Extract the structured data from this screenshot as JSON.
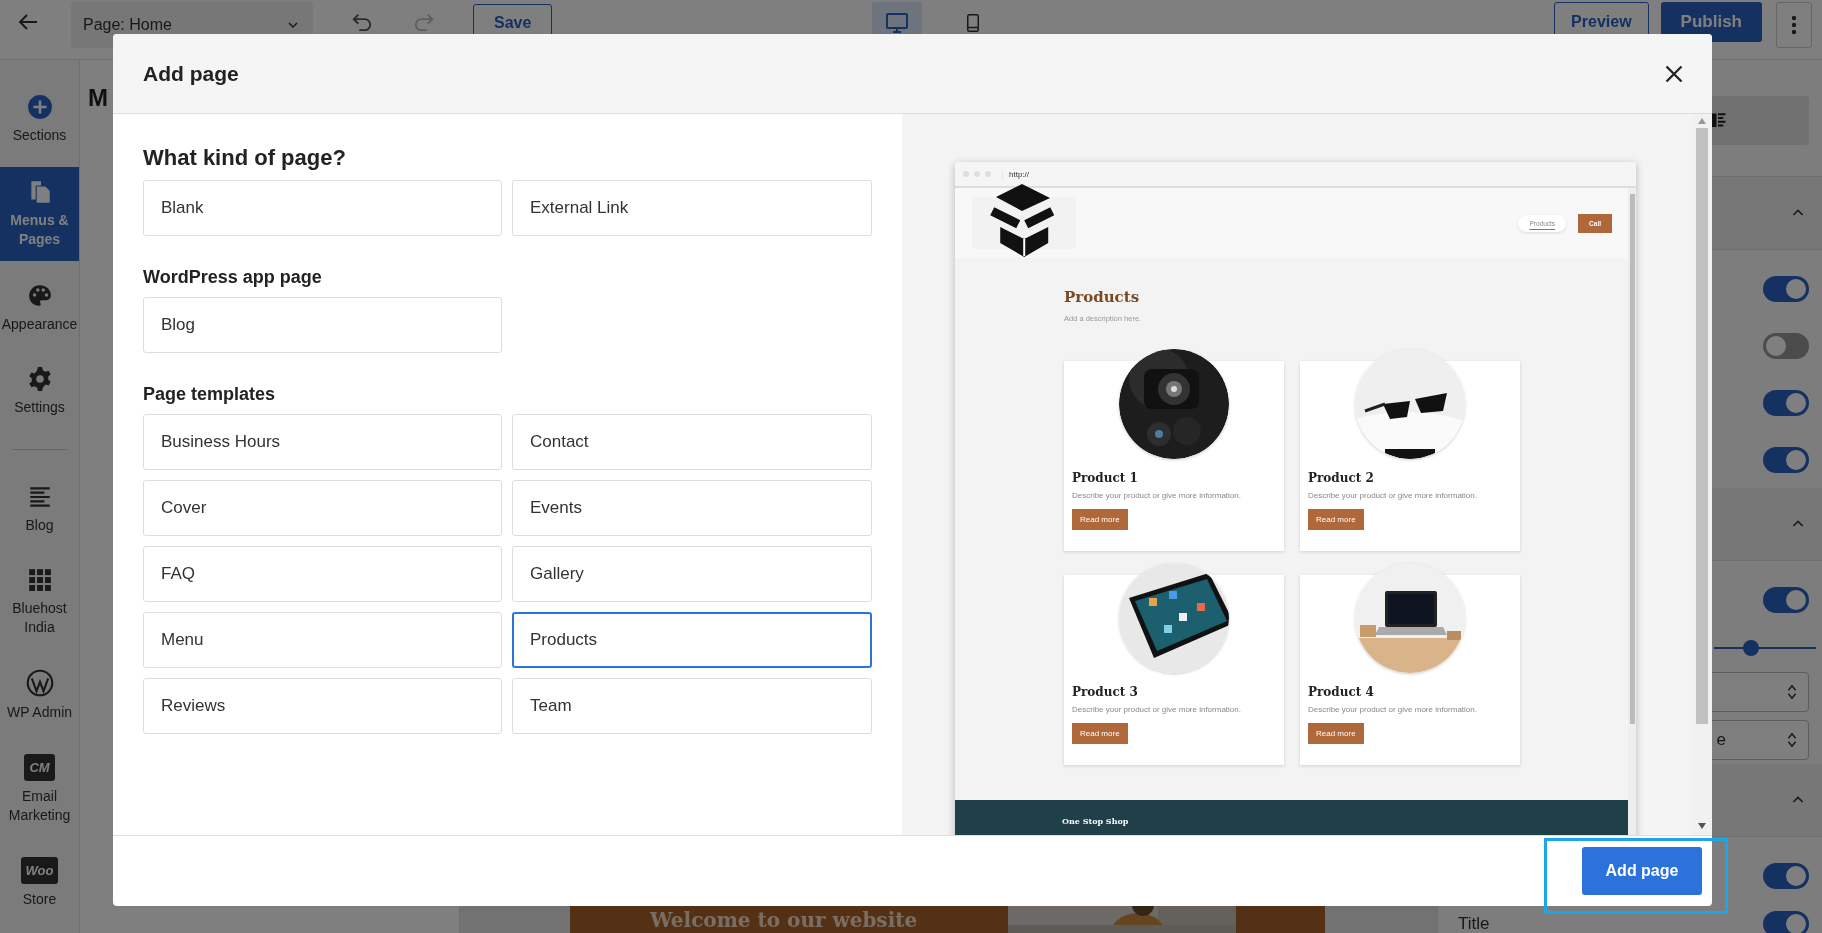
{
  "top_bar": {
    "page_select": "Page: Home",
    "save": "Save",
    "views": [
      {
        "kind": "desktop",
        "selected": true
      },
      {
        "kind": "mobile",
        "selected": false
      }
    ],
    "preview": "Preview",
    "publish": "Publish"
  },
  "sidebar": {
    "items": [
      {
        "kind": "plus",
        "label": "Sections",
        "selected": false
      },
      {
        "kind": "pages",
        "label": "Menus & Pages",
        "selected": true
      },
      {
        "kind": "palette",
        "label": "Appearance",
        "selected": false
      },
      {
        "kind": "gear",
        "label": "Settings",
        "selected": false
      },
      {
        "kind": "lines",
        "label": "Blog",
        "selected": false
      },
      {
        "kind": "grid",
        "label": "Bluehost India",
        "selected": false
      },
      {
        "kind": "wp",
        "label": "WP Admin",
        "selected": false
      },
      {
        "kind": "badge",
        "badge": "CM",
        "label": "Email Marketing",
        "selected": false
      },
      {
        "kind": "badge",
        "badge": "Woo",
        "label": "Store",
        "selected": false
      }
    ]
  },
  "panel": {
    "title": "M"
  },
  "canvas": {
    "hero_title": "Welcome to our website"
  },
  "right_panel": {
    "rows": [
      {
        "kind": "tabs"
      },
      {
        "kind": "header"
      },
      {
        "kind": "toggle",
        "on": true
      },
      {
        "kind": "toggle",
        "on": false
      },
      {
        "kind": "toggle",
        "on": true
      },
      {
        "kind": "toggle",
        "on": true
      },
      {
        "kind": "header"
      },
      {
        "kind": "toggle",
        "on": true
      },
      {
        "kind": "slider",
        "level": 0.34
      },
      {
        "kind": "select"
      },
      {
        "kind": "select",
        "value": "e"
      },
      {
        "kind": "header"
      },
      {
        "kind": "toggle",
        "on": true
      },
      {
        "kind": "labeled_toggle",
        "label": "Title",
        "on": true
      }
    ]
  },
  "modal": {
    "title": "Add page",
    "sections": [
      {
        "heading": "What kind of page?",
        "options": [
          {
            "label": "Blank",
            "selected": false
          },
          {
            "label": "External Link",
            "selected": false
          }
        ]
      },
      {
        "heading": "WordPress app page",
        "options": [
          {
            "label": "Blog",
            "selected": false
          }
        ]
      },
      {
        "heading": "Page templates",
        "options": [
          {
            "label": "Business Hours",
            "selected": false
          },
          {
            "label": "Contact",
            "selected": false
          },
          {
            "label": "Cover",
            "selected": false
          },
          {
            "label": "Events",
            "selected": false
          },
          {
            "label": "FAQ",
            "selected": false
          },
          {
            "label": "Gallery",
            "selected": false
          },
          {
            "label": "Menu",
            "selected": false
          },
          {
            "label": "Products",
            "selected": true
          },
          {
            "label": "Reviews",
            "selected": false
          },
          {
            "label": "Team",
            "selected": false
          }
        ]
      }
    ],
    "preview": {
      "url": "http://",
      "nav_link": "Products",
      "call_button": "Call",
      "title": "Products",
      "description": "Add a description here.",
      "products": [
        {
          "name": "Product 1",
          "description": "Describe your product or give more information.",
          "button": "Read more"
        },
        {
          "name": "Product 2",
          "description": "Describe your product or give more information.",
          "button": "Read more"
        },
        {
          "name": "Product 3",
          "description": "Describe your product or give more information.",
          "button": "Read more"
        },
        {
          "name": "Product 4",
          "description": "Describe your product or give more information.",
          "button": "Read more"
        }
      ],
      "footer_title": "One Stop Shop"
    },
    "add_button": "Add page"
  }
}
